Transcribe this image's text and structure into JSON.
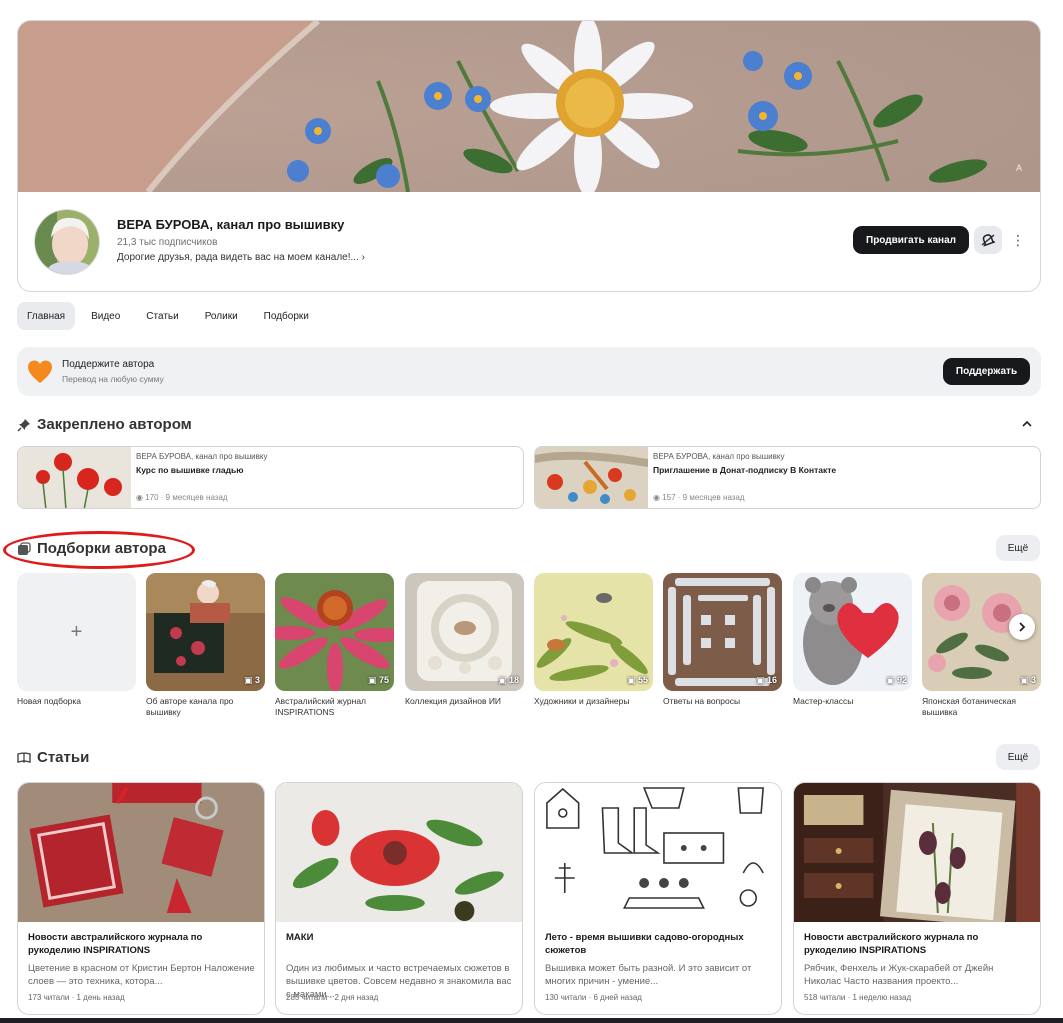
{
  "channel": {
    "name": "ВЕРА БУРОВА, канал про вышивку",
    "subscribers": "21,3 тыс подписчиков",
    "description": "Дорогие друзья, рада видеть вас на моем канале!...",
    "promote_label": "Продвигать канал"
  },
  "tabs": [
    {
      "label": "Главная",
      "active": true
    },
    {
      "label": "Видео"
    },
    {
      "label": "Статьи"
    },
    {
      "label": "Ролики"
    },
    {
      "label": "Подборки"
    }
  ],
  "support": {
    "title": "Поддержите автора",
    "subtitle": "Перевод на любую сумму",
    "button": "Поддержать"
  },
  "pinned": {
    "title": "Закреплено автором",
    "items": [
      {
        "author": "ВЕРА БУРОВА, канал про вышивку",
        "title": "Курс по вышивке гладью",
        "meta": "170 · 9 месяцев назад"
      },
      {
        "author": "ВЕРА БУРОВА, канал про вышивку",
        "title": "Приглашение в Донат-подписку В Контакте",
        "meta": "157 · 9 месяцев назад"
      }
    ]
  },
  "collections": {
    "title": "Подборки автора",
    "more": "Ещё",
    "new_label": "Новая подборка",
    "items": [
      {
        "title": "Об авторе канала про вышивку",
        "count": "3"
      },
      {
        "title": "Австралийский журнал INSPIRATIONS",
        "count": "75"
      },
      {
        "title": "Коллекция дизайнов ИИ",
        "count": "18"
      },
      {
        "title": "Художники и дизайнеры",
        "count": "55"
      },
      {
        "title": "Ответы на вопросы",
        "count": "16"
      },
      {
        "title": "Мастер-классы",
        "count": "92"
      },
      {
        "title": "Японская ботаническая вышивка",
        "count": "3"
      }
    ]
  },
  "articles": {
    "title": "Статьи",
    "more": "Ещё",
    "items": [
      {
        "title": "Новости австралийского журнала по рукоделию INSPIRATIONS",
        "snippet": "Цветение в красном от Кристин Бертон Наложение слоев — это техника, котора...",
        "meta": "173 читали · 1 день назад"
      },
      {
        "title": "МАКИ",
        "snippet": "Один из любимых и часто встречаемых сюжетов в вышивке цветов. Совсем недавно я знакомила вас с маками...",
        "meta": "285 читали · 2 дня назад"
      },
      {
        "title": "Лето - время вышивки садово-огородных сюжетов",
        "snippet": "Вышивка может быть разной. И это зависит от многих причин - умение...",
        "meta": "130 читали · 6 дней назад"
      },
      {
        "title": "Новости австралийского журнала по рукоделию INSPIRATIONS",
        "snippet": "Рябчик, Фенхель и Жук-скарабей от Джейн Николас Часто названия проекто...",
        "meta": "518 читали · 1 неделю назад"
      }
    ]
  },
  "icons": [
    "pin-icon",
    "stack-icon",
    "book-icon",
    "chevron-up-icon",
    "chevron-right-icon",
    "heart-icon",
    "bell-icon",
    "more-vertical-icon",
    "plus-icon",
    "comment-icon"
  ]
}
